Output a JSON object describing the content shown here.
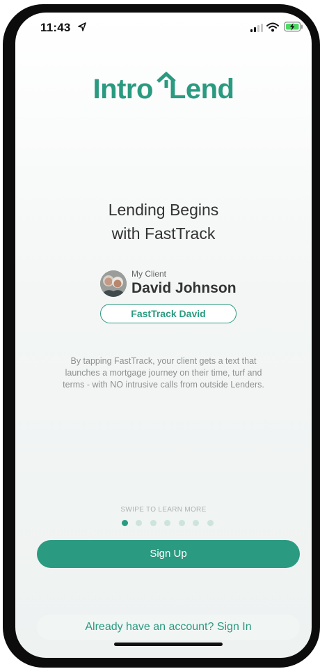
{
  "status_bar": {
    "time": "11:43",
    "icons": [
      "location-arrow-icon",
      "cellular-signal-icon",
      "wifi-icon",
      "battery-charging-icon"
    ]
  },
  "logo": {
    "text_left": "Intro",
    "text_right": "Lend",
    "icon": "house-roof-icon",
    "color": "#2a9a80"
  },
  "headline": {
    "line1": "Lending Begins",
    "line2": "with FastTrack"
  },
  "client": {
    "caption": "My Client",
    "name": "David Johnson",
    "avatar": "client-avatar"
  },
  "fasttrack_button": {
    "label": "FastTrack David"
  },
  "description": "By tapping FastTrack, your client gets a text that launches a mortgage journey on their time, turf and terms - with NO intrusive calls from outside Lenders.",
  "onboarding": {
    "swipe_hint": "SWIPE TO LEARN MORE",
    "page_count": 7,
    "active_page": 1
  },
  "signup_button": {
    "label": "Sign Up"
  },
  "signin_link": {
    "label": "Already have an account? Sign In"
  },
  "colors": {
    "accent": "#2a9a80",
    "dot_inactive": "#cde4dd",
    "background": "#f3f6f5"
  }
}
